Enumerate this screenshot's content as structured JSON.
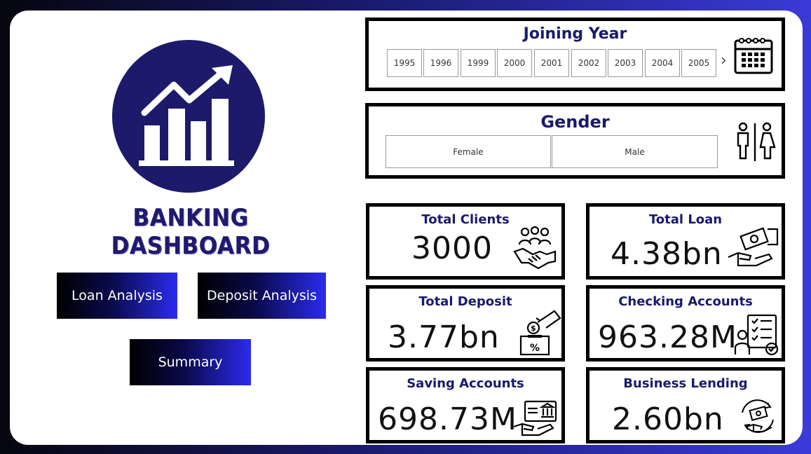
{
  "brand": {
    "title": "BANKING DASHBOARD"
  },
  "nav": {
    "loan_analysis": "Loan Analysis",
    "deposit_analysis": "Deposit Analysis",
    "summary": "Summary"
  },
  "joining_year": {
    "title": "Joining Year",
    "years": [
      "1995",
      "1996",
      "1999",
      "2000",
      "2001",
      "2002",
      "2003",
      "2004",
      "2005"
    ],
    "next_glyph": "›"
  },
  "gender": {
    "title": "Gender",
    "options": [
      "Female",
      "Male"
    ]
  },
  "kpis": {
    "total_clients": {
      "label": "Total Clients",
      "value": "3000"
    },
    "total_loan": {
      "label": "Total Loan",
      "value": "4.38bn"
    },
    "total_deposit": {
      "label": "Total Deposit",
      "value": "3.77bn"
    },
    "checking_accounts": {
      "label": "Checking Accounts",
      "value": "963.28M"
    },
    "saving_accounts": {
      "label": "Saving Accounts",
      "value": "698.73M"
    },
    "business_lending": {
      "label": "Business Lending",
      "value": "2.60bn"
    }
  },
  "colors": {
    "brand_navy": "#1d1a6b",
    "button_gradient_end": "#2b2bf0",
    "background_gradient_end": "#3a3ad8"
  }
}
